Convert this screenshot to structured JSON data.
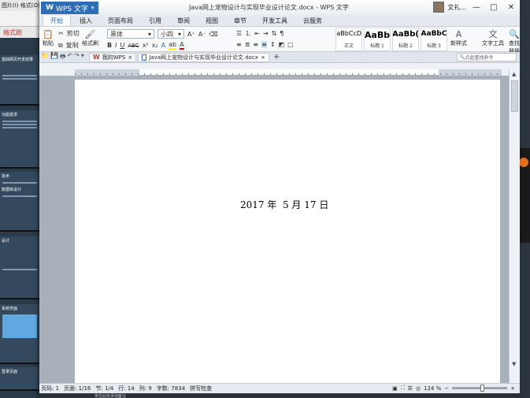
{
  "bg_app": {
    "menu": "图片(I)  格式(O)",
    "tab": "格式刷",
    "slide_texts": [
      "基础网页开发效果",
      "功能需求",
      "技术",
      "数据库设计",
      "设计",
      "系统界面",
      "登录页面"
    ]
  },
  "titlebar": {
    "app_name": "WPS 文字",
    "doc_title": "Java网上宠物设计与实现毕业设计论文.docx - WPS 文字",
    "user": "文礼..."
  },
  "ribbon_tabs": [
    "开始",
    "插入",
    "页面布局",
    "引用",
    "审阅",
    "视图",
    "章节",
    "开发工具",
    "云服务"
  ],
  "active_tab": 0,
  "ribbon": {
    "cut": "剪切",
    "copy": "复制",
    "paste": "粘贴",
    "format_painter": "格式刷",
    "font_name": "黑体",
    "font_size": "小四",
    "bold": "B",
    "italic": "I",
    "underline": "U",
    "strike": "ABC",
    "new_style": "新样式",
    "text_tools": "文字工具",
    "find_replace": "查找替换"
  },
  "styles": [
    {
      "sample": "AaBbCcDd",
      "name": "正文"
    },
    {
      "sample": "AaBb",
      "name": "标题 1"
    },
    {
      "sample": "AaBb(",
      "name": "标题 2"
    },
    {
      "sample": "AaBbC",
      "name": "标题 3"
    }
  ],
  "tabs": [
    {
      "label": "我的WPS"
    },
    {
      "label": "Java网上宠物设计与实现毕业设计论文.docx"
    }
  ],
  "find_box": "点此查找命令",
  "document": {
    "date_line": "2017 年  5 月 17 日"
  },
  "status": {
    "page": "页码: 1",
    "pages": "页面: 1/16",
    "section": "节: 1/4",
    "line": "行: 14",
    "col": "列: 9",
    "words": "字数: 7834",
    "spell": "拼写检查",
    "zoom": "124 %"
  },
  "bottom_hint": "单击此处添加备注"
}
